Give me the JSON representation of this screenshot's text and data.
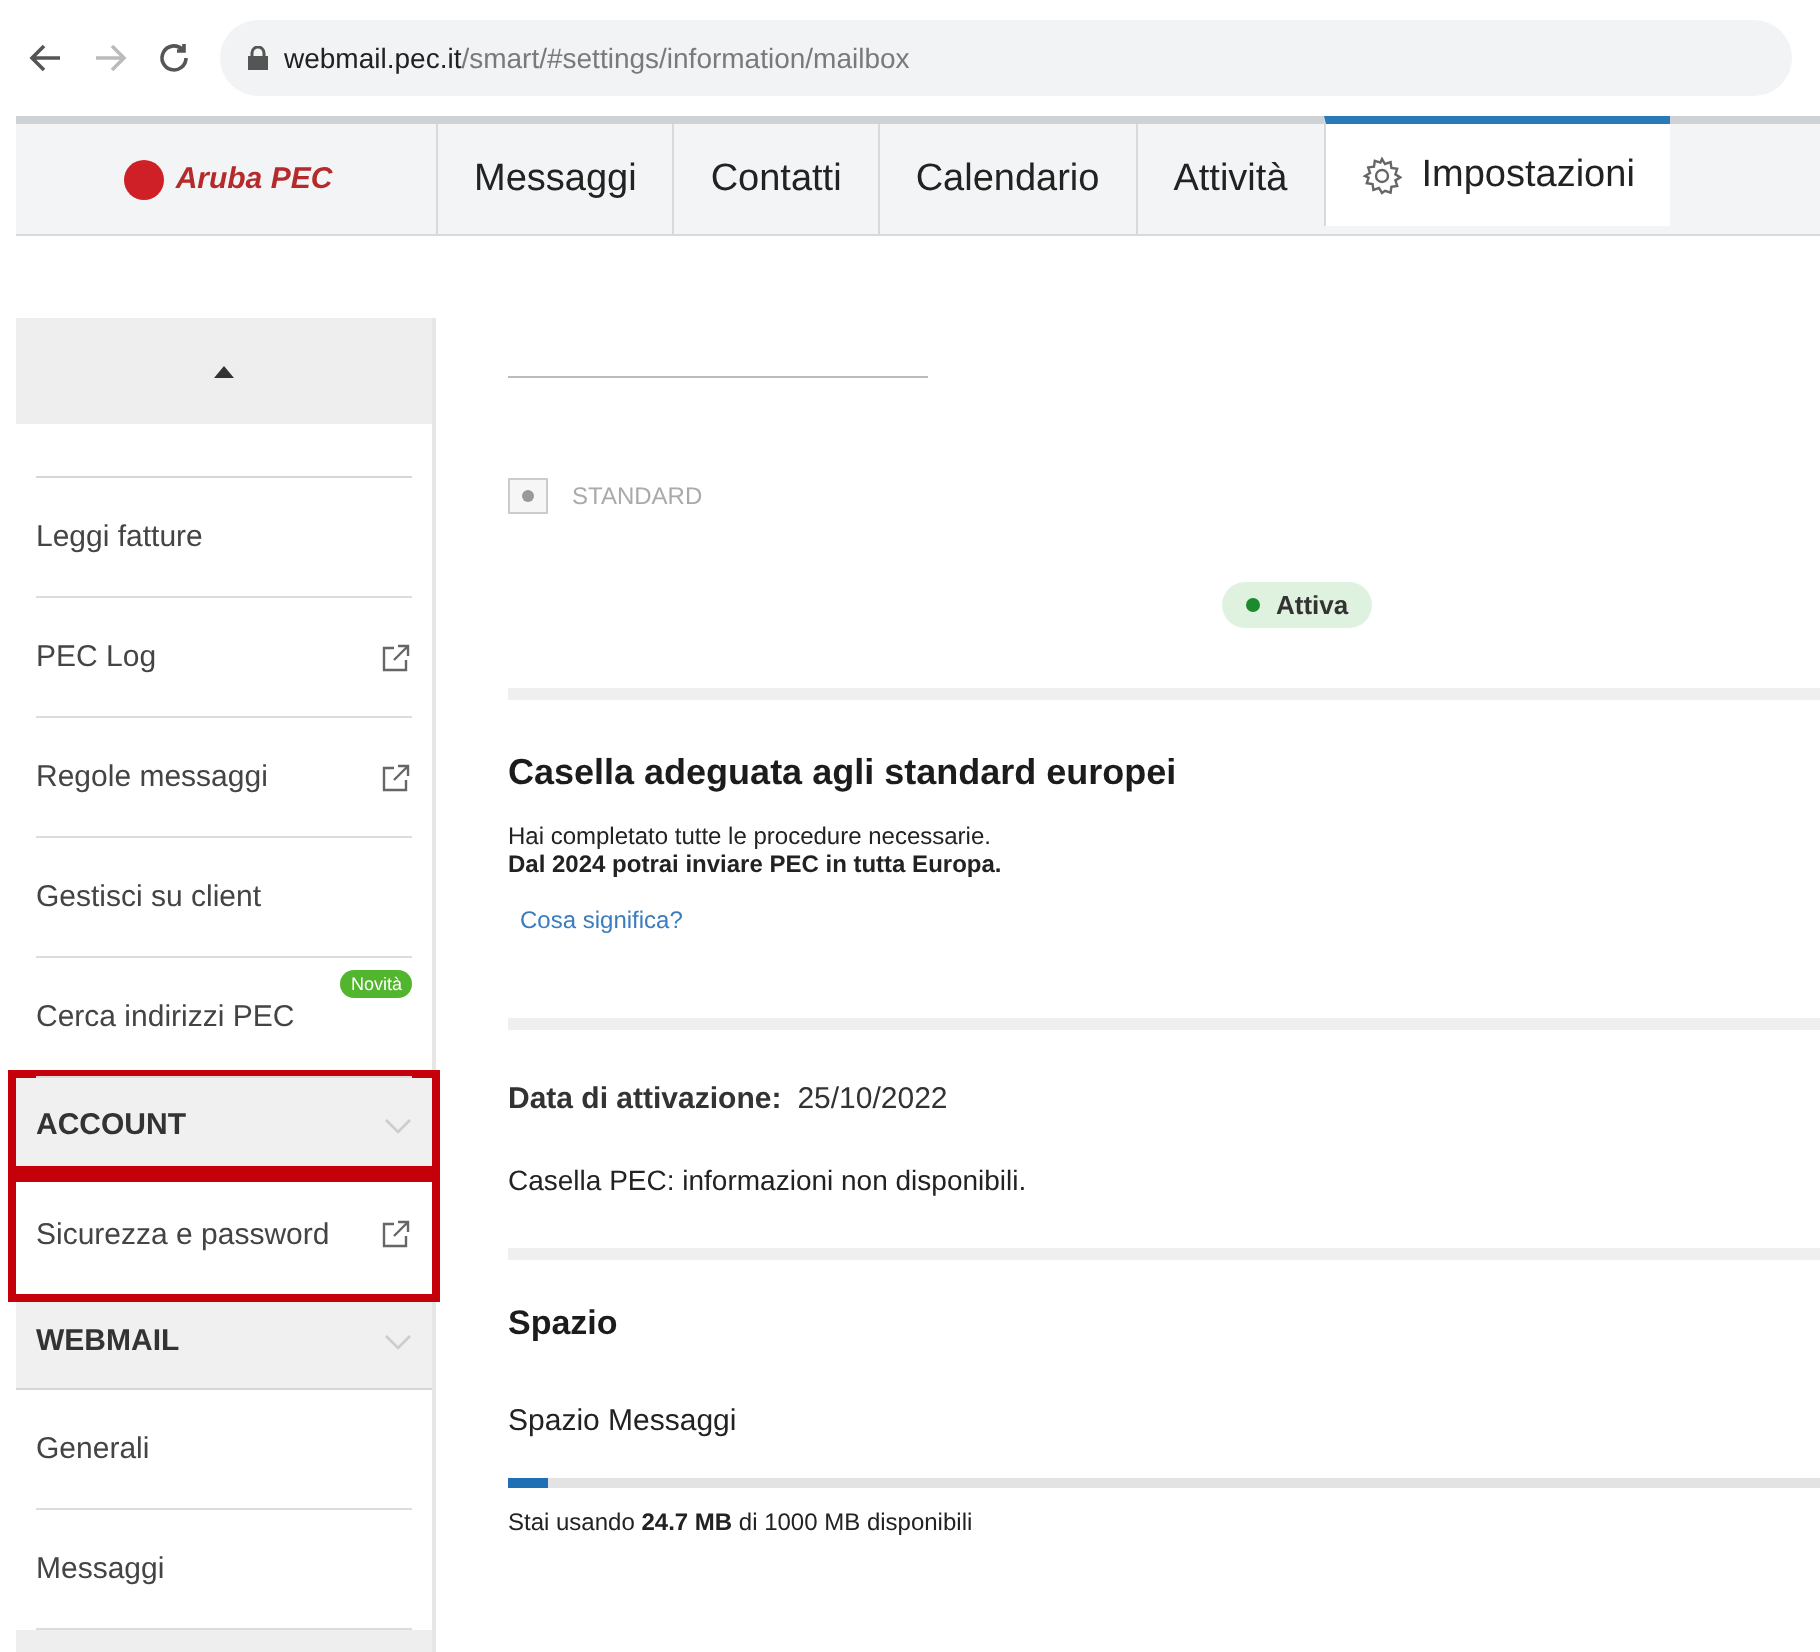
{
  "browser": {
    "url_host": "webmail.pec.it",
    "url_path": "/smart/#settings/information/mailbox"
  },
  "app": {
    "logo": "Aruba PEC",
    "tabs": [
      {
        "label": "Messaggi",
        "selected": false,
        "icon": false
      },
      {
        "label": "Contatti",
        "selected": false,
        "icon": false
      },
      {
        "label": "Calendario",
        "selected": false,
        "icon": false
      },
      {
        "label": "Attività",
        "selected": false,
        "icon": false
      },
      {
        "label": "Impostazioni",
        "selected": true,
        "icon": true
      }
    ]
  },
  "sidebar": {
    "items": [
      {
        "kind": "item",
        "label": "Leggi fatture",
        "external": false
      },
      {
        "kind": "item",
        "label": "PEC Log",
        "external": true
      },
      {
        "kind": "item",
        "label": "Regole messaggi",
        "external": true
      },
      {
        "kind": "item",
        "label": "Gestisci su client",
        "external": false
      },
      {
        "kind": "item",
        "label": "Cerca indirizzi PEC",
        "external": false,
        "badge": "Novità"
      },
      {
        "kind": "header",
        "label": "ACCOUNT",
        "highlighted": true
      },
      {
        "kind": "item",
        "label": "Sicurezza e password",
        "external": true,
        "highlighted": true
      },
      {
        "kind": "header",
        "label": "WEBMAIL",
        "highlighted": false
      },
      {
        "kind": "item",
        "label": "Generali",
        "external": false
      },
      {
        "kind": "item",
        "label": "Messaggi",
        "external": false
      }
    ]
  },
  "content": {
    "plan": "STANDARD",
    "status": {
      "label": "Attiva",
      "color": "#1e8a2e"
    },
    "compliance": {
      "title": "Casella adeguata agli standard europei",
      "lines": [
        "Hai completato tutte le procedure necessarie.",
        "**Dal 2024 potrai inviare PEC in tutta Europa.**"
      ],
      "link": "Cosa significa?"
    },
    "activation": {
      "label": "Data di attivazione:",
      "value": "25/10/2022"
    },
    "mailbox_info": "Casella PEC: informazioni non disponibili.",
    "space": {
      "title": "Spazio",
      "meter": {
        "label": "Spazio Messaggi",
        "level": 0.03,
        "reading": "Stai usando **24.7 MB** di 1000 MB disponibili"
      }
    }
  }
}
